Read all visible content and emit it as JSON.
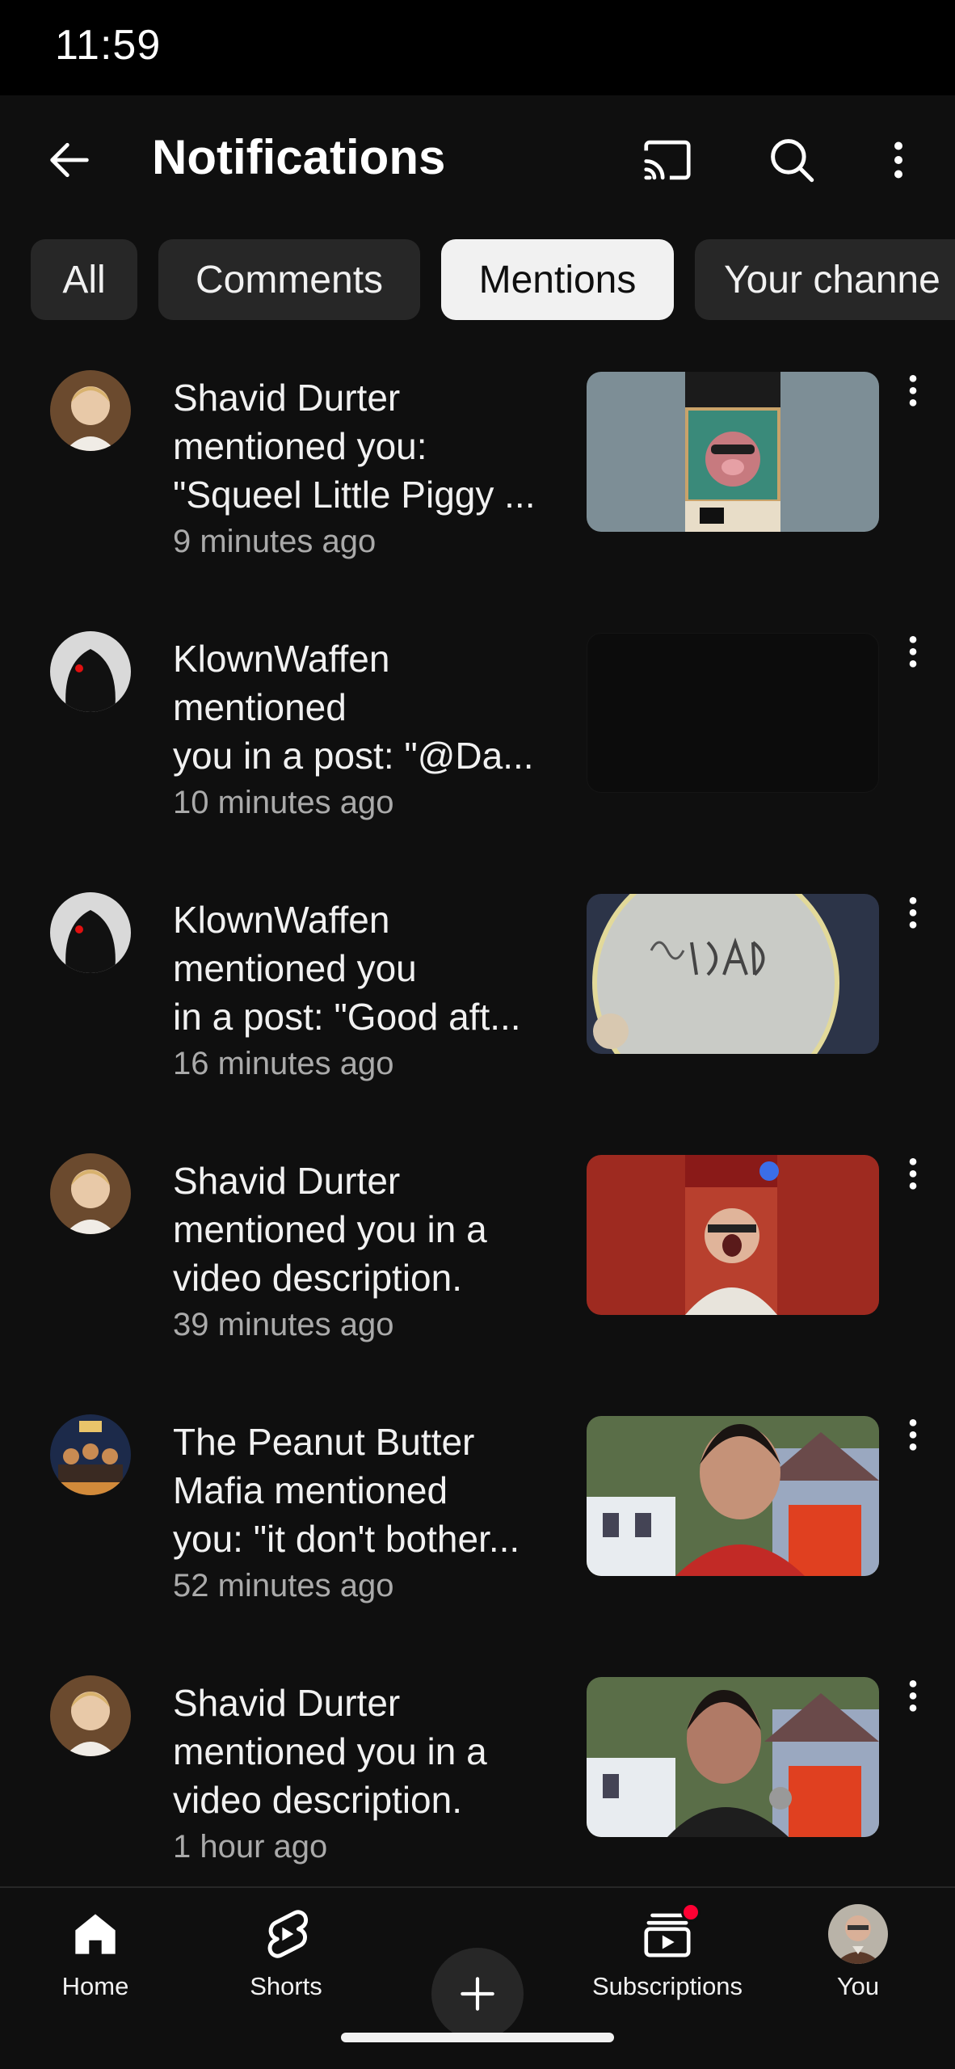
{
  "status_bar": {
    "time": "11:59"
  },
  "header": {
    "title": "Notifications"
  },
  "chips": [
    "All",
    "Comments",
    "Mentions",
    "Your channe"
  ],
  "active_chip": "Mentions",
  "notifications": [
    {
      "lines": [
        "Shavid Durter",
        "mentioned you:",
        "\"Squeel Little Piggy ..."
      ],
      "time": "9 minutes ago",
      "thumbnail": "peanut-butter-mafia-pig-poster"
    },
    {
      "lines": [
        "KlownWaffen",
        "mentioned",
        "you in a post: \"@Da..."
      ],
      "time": "10 minutes ago",
      "thumbnail": "dark-blank"
    },
    {
      "lines": [
        "KlownWaffen",
        "mentioned you",
        "in a post: \"Good aft..."
      ],
      "time": "16 minutes ago",
      "thumbnail": "dad-is-plate"
    },
    {
      "lines": [
        "Shavid Durter",
        "mentioned you in a",
        "video description."
      ],
      "time": "39 minutes ago",
      "thumbnail": "man-red-background"
    },
    {
      "lines": [
        "The Peanut Butter",
        "Mafia mentioned",
        "you: \"it don't bother..."
      ],
      "time": "52 minutes ago",
      "thumbnail": "man-burning-house"
    },
    {
      "lines": [
        "Shavid Durter",
        "mentioned you in a",
        "video description."
      ],
      "time": "1 hour ago",
      "thumbnail": "man-microphone-burning-house"
    }
  ],
  "bottom_nav": {
    "home": "Home",
    "shorts": "Shorts",
    "subscriptions": "Subscriptions",
    "you": "You"
  },
  "colors": {
    "background": "#0f0f0f",
    "chip": "#272727",
    "chip_active": "#f1f1f1",
    "secondary_text": "#aaaaaa",
    "badge": "#ff0033"
  }
}
